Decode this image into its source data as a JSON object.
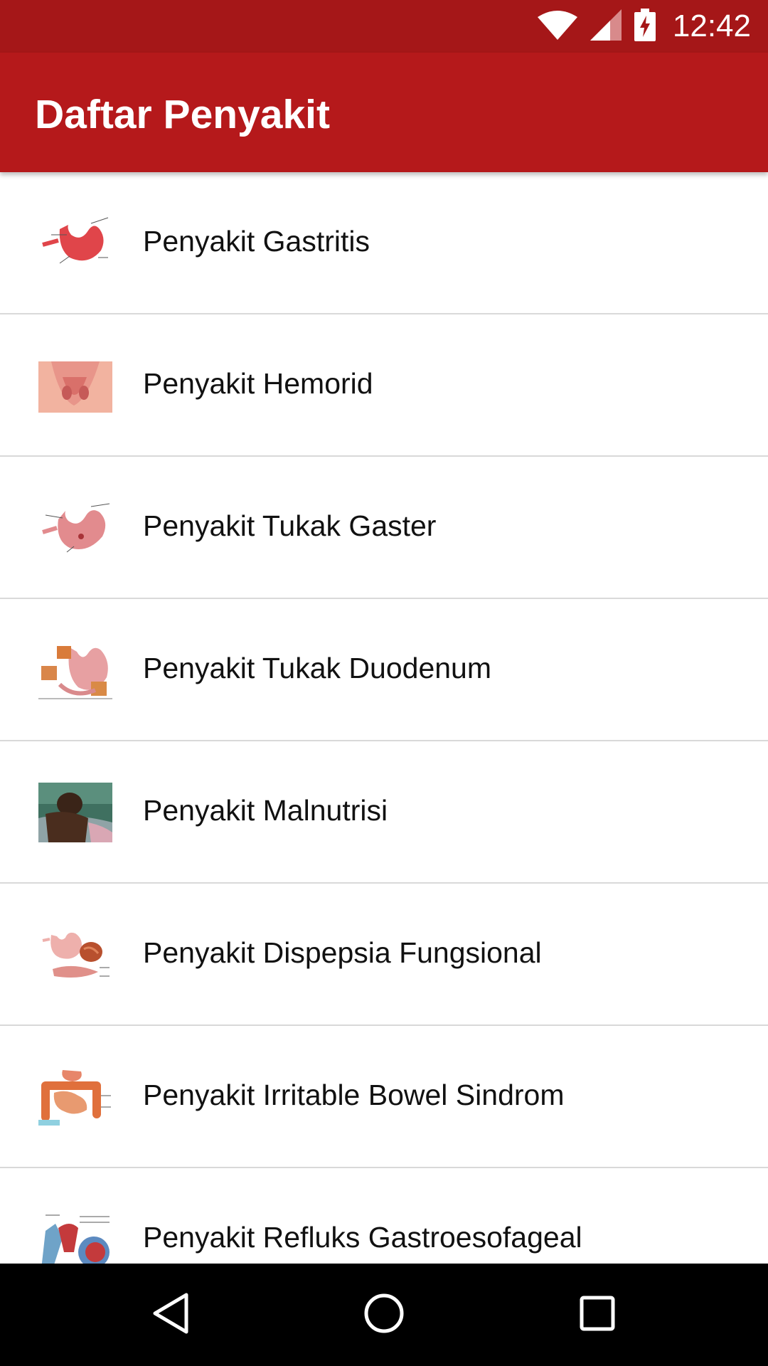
{
  "status_bar": {
    "time": "12:42",
    "icons": [
      "wifi-icon",
      "signal-icon",
      "battery-charging-icon"
    ],
    "background": "#a51718"
  },
  "app_bar": {
    "title": "Daftar Penyakit",
    "background": "#b5191b"
  },
  "list": {
    "items": [
      {
        "label": "Penyakit Gastritis",
        "thumbnail": "stomach-diagram-thumbnail"
      },
      {
        "label": "Penyakit Hemorid",
        "thumbnail": "hemorrhoid-diagram-thumbnail"
      },
      {
        "label": "Penyakit Tukak Gaster",
        "thumbnail": "gastric-ulcer-diagram-thumbnail"
      },
      {
        "label": "Penyakit Tukak Duodenum",
        "thumbnail": "duodenal-ulcer-diagram-thumbnail"
      },
      {
        "label": "Penyakit Malnutrisi",
        "thumbnail": "malnutrition-photo-thumbnail"
      },
      {
        "label": "Penyakit Dispepsia Fungsional",
        "thumbnail": "dyspepsia-diagram-thumbnail"
      },
      {
        "label": "Penyakit Irritable Bowel Sindrom",
        "thumbnail": "intestine-diagram-thumbnail"
      },
      {
        "label": "Penyakit Refluks Gastroesofageal",
        "thumbnail": "reflux-diagram-thumbnail"
      }
    ]
  },
  "nav_bar": {
    "buttons": [
      "back-icon",
      "home-icon",
      "recents-icon"
    ]
  }
}
